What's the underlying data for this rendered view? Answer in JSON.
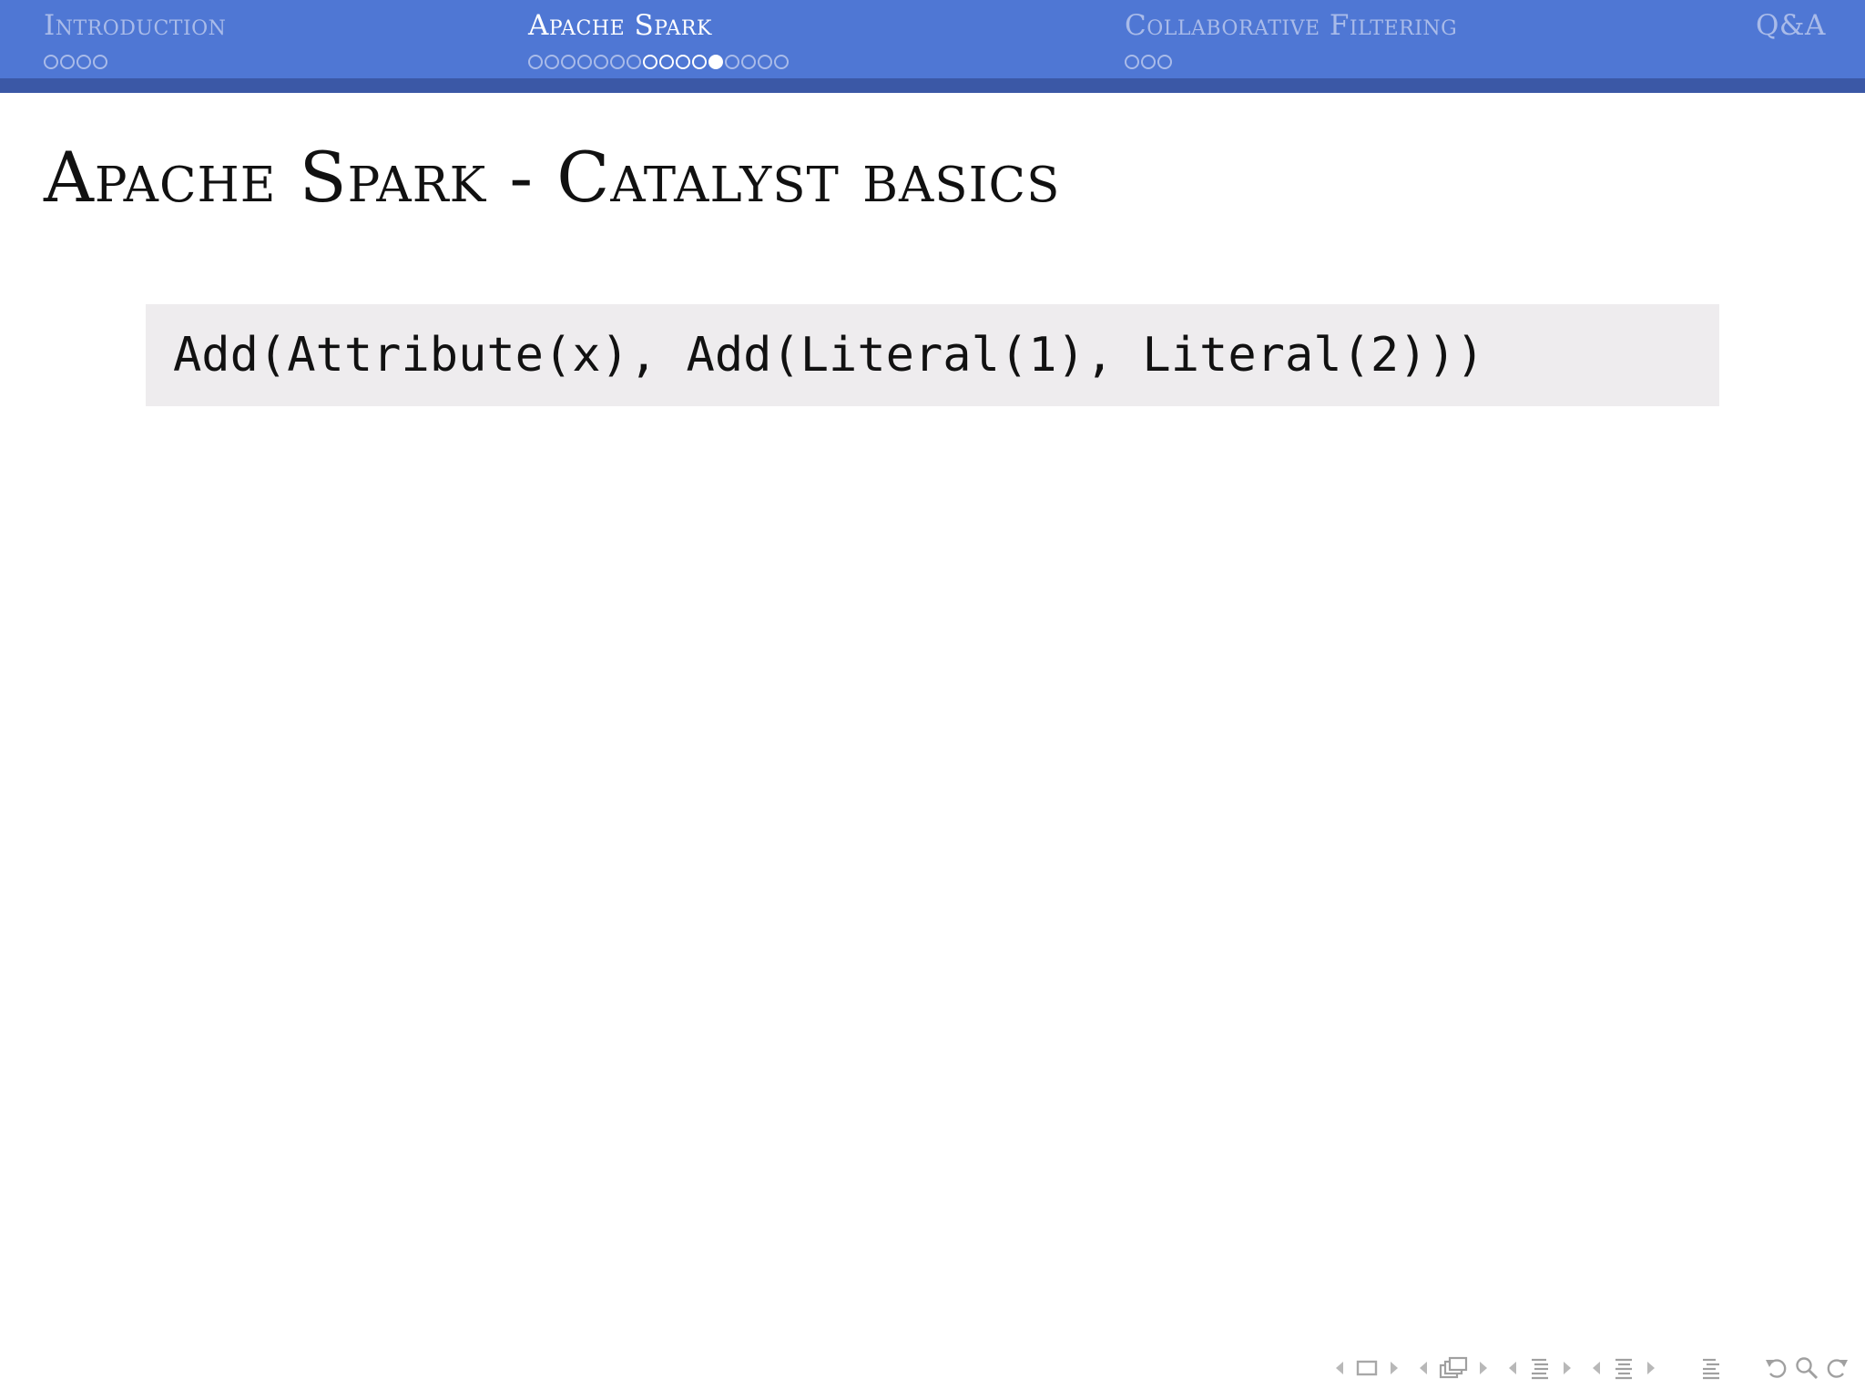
{
  "header": {
    "sections": [
      {
        "label": "Introduction",
        "dots": 4,
        "active": false
      },
      {
        "label": "Apache Spark",
        "dots": 16,
        "active": true
      },
      {
        "label": "Collaborative Filtering",
        "dots": 3,
        "active": false
      },
      {
        "label": "Q&A",
        "dots": 0,
        "active": false
      }
    ]
  },
  "frame": {
    "title": "Apache Spark - Catalyst basics",
    "code": "Add(Attribute(x), Add(Literal(1), Literal(2)))"
  },
  "colors": {
    "header_bg": "#4f77d4",
    "header_strip": "#3b58a6",
    "inactive_text": "#a9bbe9",
    "active_text": "#ffffff",
    "code_bg": "#eeecee"
  },
  "nav_icons": [
    "prev-slide-icon",
    "frame-icon",
    "next-slide-icon",
    "prev-subsection-icon",
    "subsection-icon",
    "next-subsection-icon",
    "prev-section-icon",
    "section-icon",
    "next-section-icon",
    "prev-document-icon",
    "document-icon",
    "next-document-icon",
    "appendix-icon",
    "back-icon",
    "search-icon",
    "forward-icon"
  ]
}
